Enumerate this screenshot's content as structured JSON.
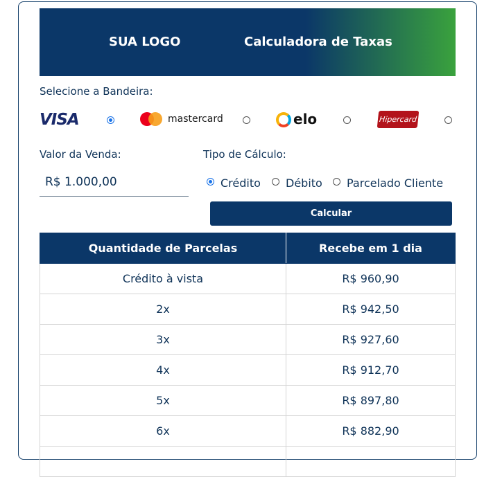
{
  "banner": {
    "logo_text": "SUA LOGO",
    "title": "Calculadora de Taxas"
  },
  "brand_section": {
    "label": "Selecione a Bandeira:",
    "brands": [
      {
        "name": "VISA",
        "selected": true
      },
      {
        "name": "mastercard",
        "selected": false
      },
      {
        "name": "elo",
        "selected": false
      },
      {
        "name": "Hipercard",
        "selected": false
      }
    ]
  },
  "sale": {
    "label": "Valor da Venda:",
    "value": "R$ 1.000,00"
  },
  "calc_type": {
    "label": "Tipo de Cálculo:",
    "options": [
      {
        "label": "Crédito",
        "selected": true
      },
      {
        "label": "Débito",
        "selected": false
      },
      {
        "label": "Parcelado Cliente",
        "selected": false
      }
    ]
  },
  "calculate_button": "Calcular",
  "table": {
    "headers": [
      "Quantidade de Parcelas",
      "Recebe em 1 dia"
    ],
    "rows": [
      [
        "Crédito à vista",
        "R$ 960,90"
      ],
      [
        "2x",
        "R$ 942,50"
      ],
      [
        "3x",
        "R$ 927,60"
      ],
      [
        "4x",
        "R$ 912,70"
      ],
      [
        "5x",
        "R$ 897,80"
      ],
      [
        "6x",
        "R$ 882,90"
      ],
      [
        "",
        ""
      ]
    ]
  },
  "colors": {
    "primary": "#0b3768",
    "accent_green": "#3aa23d",
    "radio_checked": "#1a73e8"
  }
}
